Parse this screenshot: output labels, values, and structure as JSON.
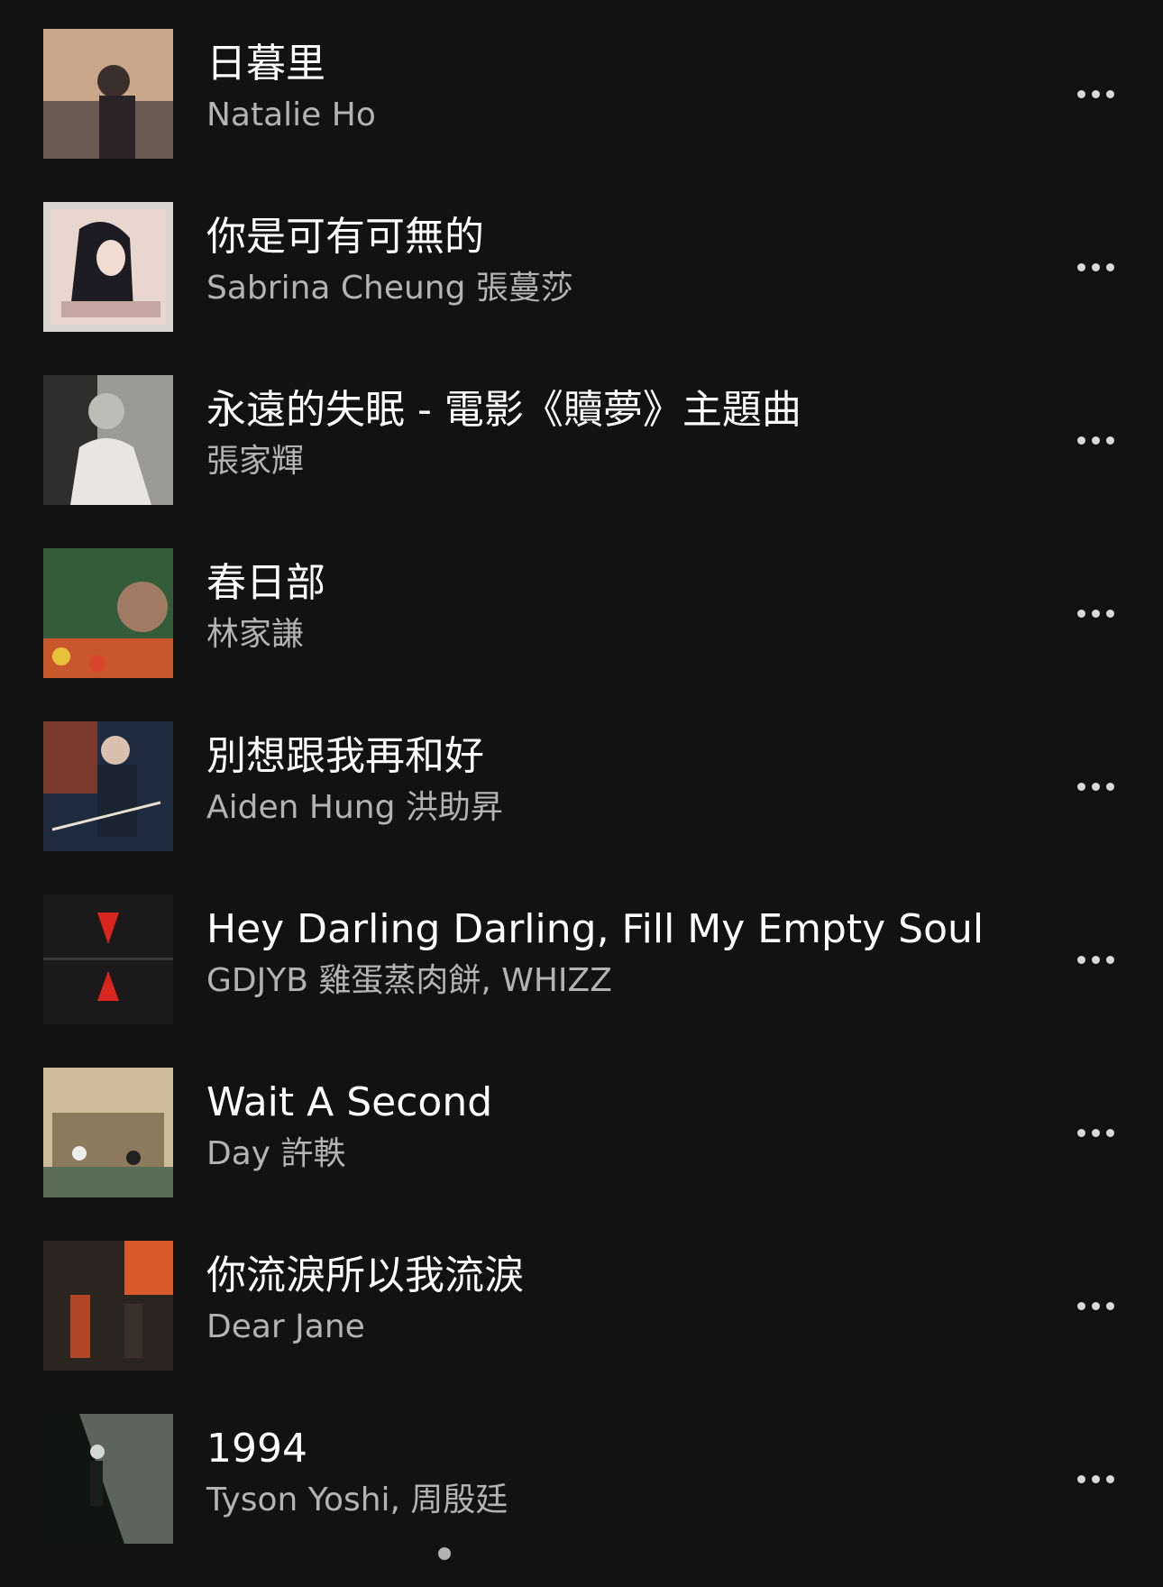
{
  "tracks": [
    {
      "title": "日暮里",
      "artist": "Natalie Ho",
      "cover_icon": "album-art-dusk-couple",
      "cover_colors": [
        "#c9a68a",
        "#6b5a52"
      ]
    },
    {
      "title": "你是可有可無的",
      "artist": "Sabrina Cheung 張蔓莎",
      "cover_icon": "album-art-woman-portrait",
      "cover_colors": [
        "#e9d6cf",
        "#1c1c22"
      ]
    },
    {
      "title": "永遠的失眠 - 電影《贖夢》主題曲",
      "artist": "張家輝",
      "cover_icon": "album-art-man-bw",
      "cover_colors": [
        "#9a9a96",
        "#2e2e2e"
      ]
    },
    {
      "title": "春日部",
      "artist": "林家謙",
      "cover_icon": "album-art-flowers",
      "cover_colors": [
        "#355c3a",
        "#c9572c"
      ]
    },
    {
      "title": "別想跟我再和好",
      "artist": "Aiden Hung 洪助昇",
      "cover_icon": "album-art-man-suit",
      "cover_colors": [
        "#7a3a2c",
        "#1f2c3f"
      ]
    },
    {
      "title": "Hey Darling Darling, Fill My Empty Soul",
      "artist": "GDJYB 雞蛋蒸肉餅, WHIZZ",
      "cover_icon": "album-art-red-arrows",
      "cover_colors": [
        "#1a1a1a",
        "#d8261f"
      ]
    },
    {
      "title": "Wait A Second",
      "artist": "Day 許軼",
      "cover_icon": "album-art-street-scene",
      "cover_colors": [
        "#cdbb9a",
        "#5a6e55"
      ]
    },
    {
      "title": "你流淚所以我流淚",
      "artist": "Dear Jane",
      "cover_icon": "album-art-night-street",
      "cover_colors": [
        "#2b2520",
        "#d85a2a"
      ]
    },
    {
      "title": "1994",
      "artist": "Tyson Yoshi, 周殷廷",
      "cover_icon": "album-art-dark-figure",
      "cover_colors": [
        "#0f1512",
        "#9aa89c"
      ]
    }
  ],
  "more_icon": "more-options-icon",
  "theme": {
    "background": "#121212",
    "title_color": "#ffffff",
    "artist_color": "#b3b3b3"
  }
}
